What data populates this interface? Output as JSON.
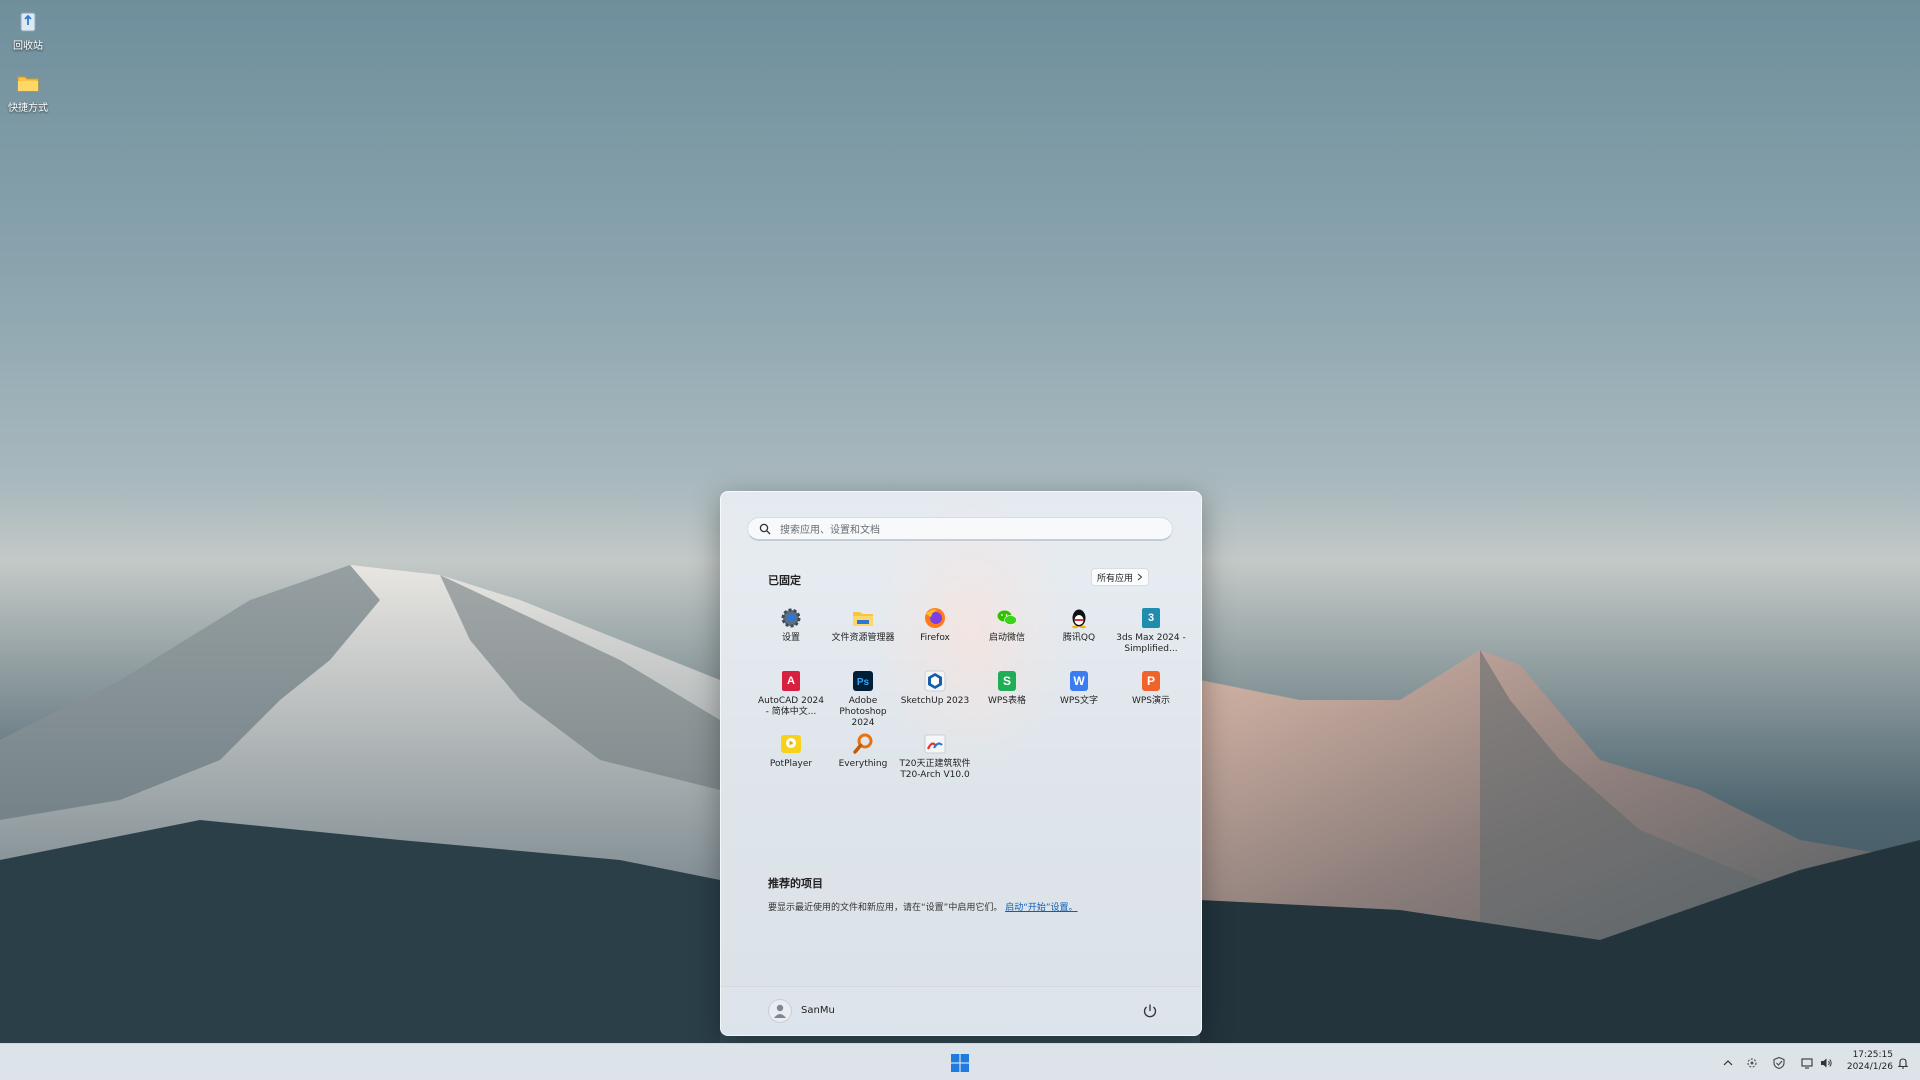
{
  "desktop": {
    "icons": [
      {
        "label": "回收站",
        "icon": "recycle-bin-icon"
      },
      {
        "label": "快捷方式",
        "icon": "folder-icon"
      }
    ]
  },
  "start_menu": {
    "search": {
      "placeholder": "搜索应用、设置和文档"
    },
    "pinned": {
      "title": "已固定",
      "all_apps_label": "所有应用",
      "apps": [
        {
          "label": "设置",
          "icon": "settings-gear-icon"
        },
        {
          "label": "文件资源管理器",
          "icon": "file-explorer-icon"
        },
        {
          "label": "Firefox",
          "icon": "firefox-icon"
        },
        {
          "label": "启动微信",
          "icon": "wechat-icon"
        },
        {
          "label": "腾讯QQ",
          "icon": "qq-penguin-icon"
        },
        {
          "label": "3ds Max 2024 - Simplified...",
          "icon": "3dsmax-icon"
        },
        {
          "label": "AutoCAD 2024 - 简体中文...",
          "icon": "autocad-icon"
        },
        {
          "label": "Adobe Photoshop 2024",
          "icon": "photoshop-icon"
        },
        {
          "label": "SketchUp 2023",
          "icon": "sketchup-icon"
        },
        {
          "label": "WPS表格",
          "icon": "wps-spreadsheet-icon"
        },
        {
          "label": "WPS文字",
          "icon": "wps-writer-icon"
        },
        {
          "label": "WPS演示",
          "icon": "wps-presentation-icon"
        },
        {
          "label": "PotPlayer",
          "icon": "potplayer-icon"
        },
        {
          "label": "Everything",
          "icon": "everything-search-icon"
        },
        {
          "label": "T20天正建筑软件 T20-Arch V10.0",
          "icon": "t20-arch-icon"
        }
      ]
    },
    "recommended": {
      "title": "推荐的项目",
      "message": "要显示最近使用的文件和新应用，请在“设置”中启用它们。",
      "link": "启动“开始”设置。"
    },
    "footer": {
      "user_name": "SanMu",
      "power_icon": "power-icon"
    }
  },
  "taskbar": {
    "start_icon": "windows-logo-icon",
    "tray": {
      "icons": [
        "chevron-up-icon",
        "network-settings-icon",
        "security-shield-icon",
        "display-icon",
        "volume-icon",
        "notification-bell-icon"
      ],
      "time": "17:25:15",
      "date": "2024/1/26"
    }
  },
  "colors": {
    "accent": "#0a5fb8",
    "windows_blue": "#1e7be0"
  }
}
